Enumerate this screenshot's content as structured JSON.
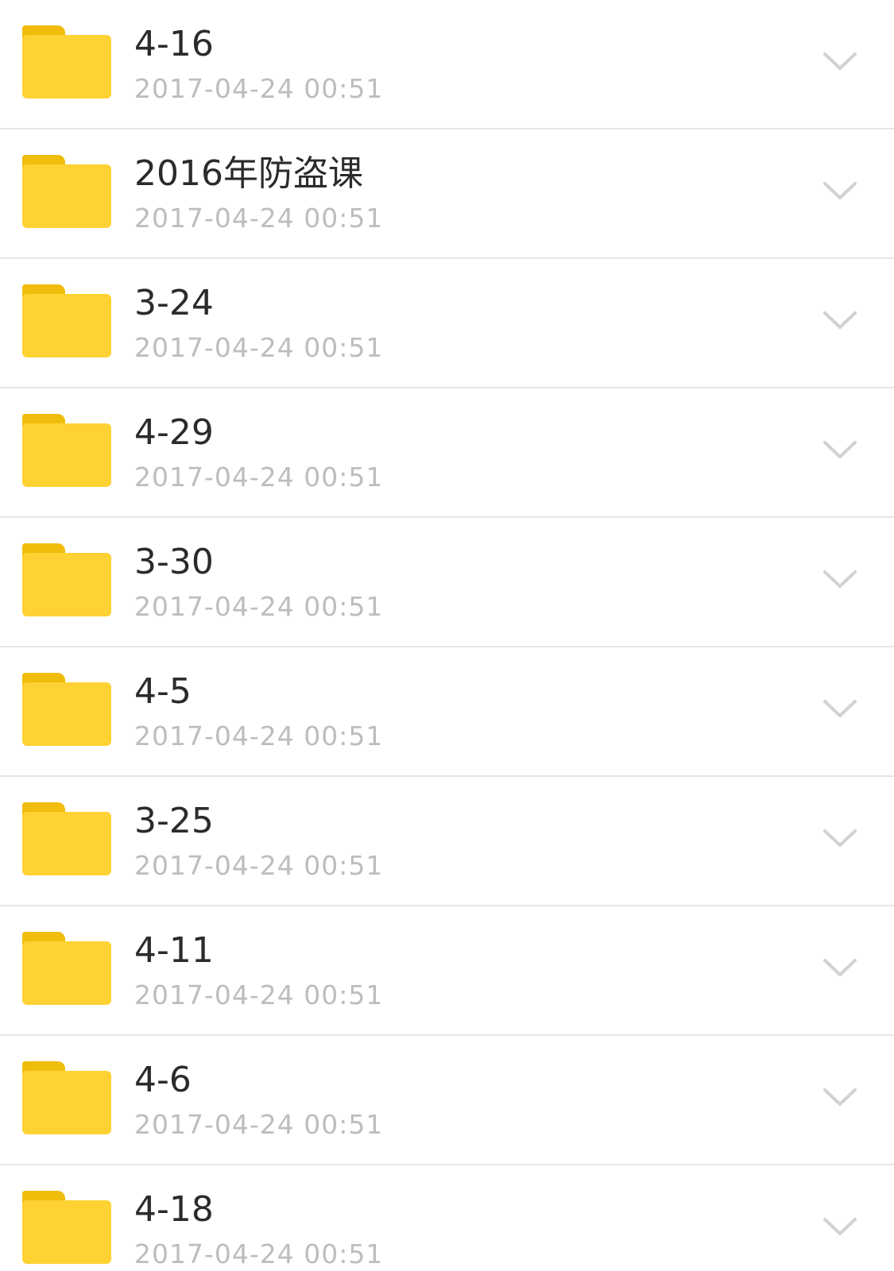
{
  "colors": {
    "folder_body": "#FFD233",
    "folder_tab": "#F1BD0C",
    "title_text": "#2b2b2b",
    "date_text": "#bdbdbd",
    "divider": "#e6e6e6",
    "chevron": "#d2d2d2"
  },
  "files": [
    {
      "name": "4-16",
      "date": "2017-04-24 00:51",
      "icon": "folder-icon",
      "action_icon": "chevron-down-icon"
    },
    {
      "name": "2016年防盗课",
      "date": "2017-04-24 00:51",
      "icon": "folder-icon",
      "action_icon": "chevron-down-icon"
    },
    {
      "name": "3-24",
      "date": "2017-04-24 00:51",
      "icon": "folder-icon",
      "action_icon": "chevron-down-icon"
    },
    {
      "name": "4-29",
      "date": "2017-04-24 00:51",
      "icon": "folder-icon",
      "action_icon": "chevron-down-icon"
    },
    {
      "name": "3-30",
      "date": "2017-04-24 00:51",
      "icon": "folder-icon",
      "action_icon": "chevron-down-icon"
    },
    {
      "name": "4-5",
      "date": "2017-04-24 00:51",
      "icon": "folder-icon",
      "action_icon": "chevron-down-icon"
    },
    {
      "name": "3-25",
      "date": "2017-04-24 00:51",
      "icon": "folder-icon",
      "action_icon": "chevron-down-icon"
    },
    {
      "name": "4-11",
      "date": "2017-04-24 00:51",
      "icon": "folder-icon",
      "action_icon": "chevron-down-icon"
    },
    {
      "name": "4-6",
      "date": "2017-04-24 00:51",
      "icon": "folder-icon",
      "action_icon": "chevron-down-icon"
    },
    {
      "name": "4-18",
      "date": "2017-04-24 00:51",
      "icon": "folder-icon",
      "action_icon": "chevron-down-icon"
    }
  ]
}
